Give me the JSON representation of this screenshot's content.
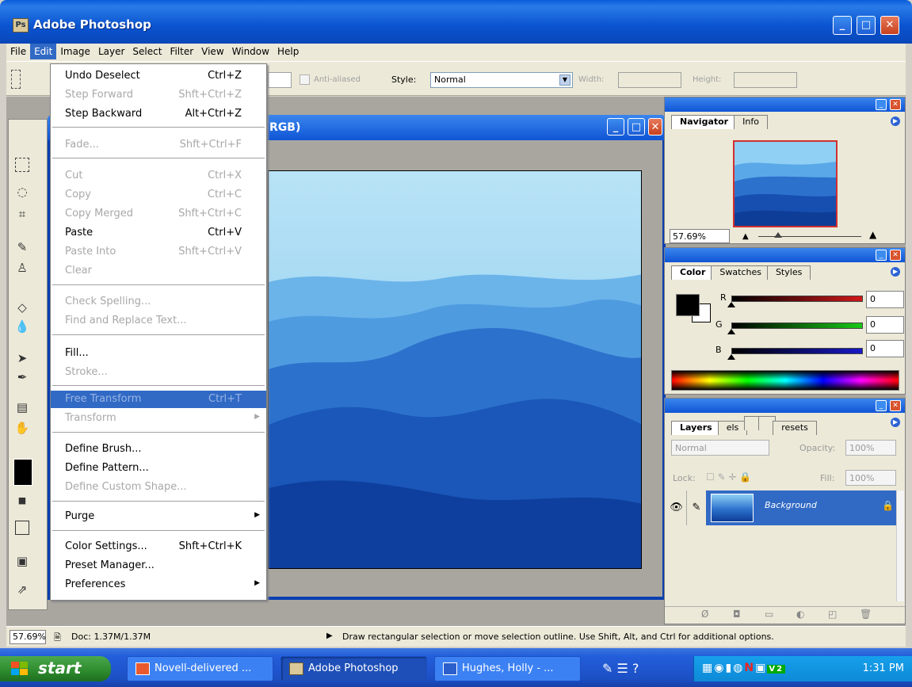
{
  "app": {
    "title": "Adobe Photoshop",
    "icon": "photoshop-icon"
  },
  "menubar": [
    "File",
    "Edit",
    "Image",
    "Layer",
    "Select",
    "Filter",
    "View",
    "Window",
    "Help"
  ],
  "options": {
    "anti_aliased": "Anti-aliased",
    "style_label": "Style:",
    "style_value": "Normal",
    "width_label": "Width:",
    "height_label": "Height:"
  },
  "document": {
    "title_suffix": "RGB)"
  },
  "edit_menu": {
    "items": [
      {
        "label": "Undo Deselect",
        "shortcut": "Ctrl+Z",
        "enabled": true
      },
      {
        "label": "Step Forward",
        "shortcut": "Shft+Ctrl+Z",
        "enabled": false
      },
      {
        "label": "Step Backward",
        "shortcut": "Alt+Ctrl+Z",
        "enabled": true
      },
      {
        "label": "Fade...",
        "shortcut": "Shft+Ctrl+F",
        "enabled": false
      },
      {
        "label": "Cut",
        "shortcut": "Ctrl+X",
        "enabled": false
      },
      {
        "label": "Copy",
        "shortcut": "Ctrl+C",
        "enabled": false
      },
      {
        "label": "Copy Merged",
        "shortcut": "Shft+Ctrl+C",
        "enabled": false
      },
      {
        "label": "Paste",
        "shortcut": "Ctrl+V",
        "enabled": true
      },
      {
        "label": "Paste Into",
        "shortcut": "Shft+Ctrl+V",
        "enabled": false
      },
      {
        "label": "Clear",
        "shortcut": "",
        "enabled": false
      },
      {
        "label": "Check Spelling...",
        "shortcut": "",
        "enabled": false
      },
      {
        "label": "Find and Replace Text...",
        "shortcut": "",
        "enabled": false
      },
      {
        "label": "Fill...",
        "shortcut": "",
        "enabled": true
      },
      {
        "label": "Stroke...",
        "shortcut": "",
        "enabled": false
      },
      {
        "label": "Free Transform",
        "shortcut": "Ctrl+T",
        "enabled": false,
        "highlighted": true
      },
      {
        "label": "Transform",
        "shortcut": "",
        "enabled": false,
        "submenu": true
      },
      {
        "label": "Define Brush...",
        "shortcut": "",
        "enabled": true
      },
      {
        "label": "Define Pattern...",
        "shortcut": "",
        "enabled": true
      },
      {
        "label": "Define Custom Shape...",
        "shortcut": "",
        "enabled": false
      },
      {
        "label": "Purge",
        "shortcut": "",
        "enabled": true,
        "submenu": true
      },
      {
        "label": "Color Settings...",
        "shortcut": "Shft+Ctrl+K",
        "enabled": true
      },
      {
        "label": "Preset Manager...",
        "shortcut": "",
        "enabled": true
      },
      {
        "label": "Preferences",
        "shortcut": "",
        "enabled": true,
        "submenu": true
      }
    ]
  },
  "navigator": {
    "tabs": [
      "Navigator",
      "Info"
    ],
    "zoom": "57.69%"
  },
  "color": {
    "tabs": [
      "Color",
      "Swatches",
      "Styles"
    ],
    "r_label": "R",
    "g_label": "G",
    "b_label": "B",
    "r": "0",
    "g": "0",
    "b": "0"
  },
  "layers": {
    "tabs": [
      "Layers",
      "els",
      "",
      "",
      "resets"
    ],
    "blend": "Normal",
    "opacity_label": "Opacity:",
    "opacity": "100%",
    "lock_label": "Lock:",
    "fill_label": "Fill:",
    "fill": "100%",
    "layer_name": "Background"
  },
  "status": {
    "zoom": "57.69%",
    "doc": "Doc: 1.37M/1.37M",
    "hint": "Draw rectangular selection or move selection outline. Use Shift, Alt, and Ctrl for additional options."
  },
  "taskbar": {
    "start": "start",
    "items": [
      "Novell-delivered ...",
      "Adobe Photoshop",
      "Hughes, Holly - ..."
    ],
    "clock": "1:31 PM"
  },
  "colors": {
    "accent": "#316ac5",
    "titlebar": "#0a53d0"
  }
}
